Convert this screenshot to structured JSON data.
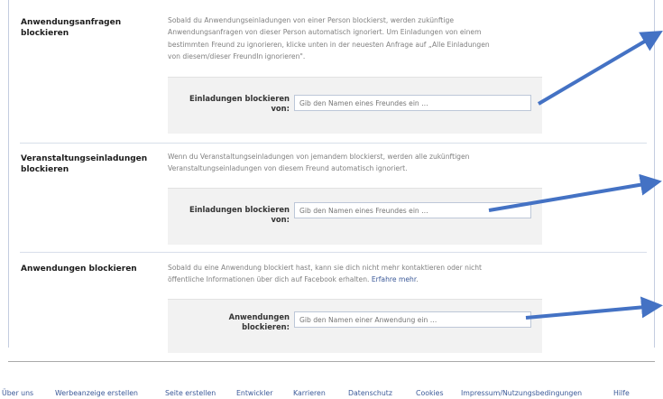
{
  "sections": [
    {
      "title_line1": "Anwendungsanfragen",
      "title_line2": "blockieren",
      "desc_lines": [
        "Sobald du Anwendungseinladungen von einer Person blockierst, werden zukünftige",
        "Anwendungsanfragen von dieser Person automatisch ignoriert. Um Einladungen von einem",
        "bestimmten Freund zu ignorieren, klicke unten in der neuesten Anfrage auf „Alle Einladungen",
        "von diesem/dieser FreundIn ignorieren\"."
      ],
      "field_label_line1": "Einladungen blockieren",
      "field_label_line2": "von:",
      "placeholder": "Gib den Namen eines Freundes ein …"
    },
    {
      "title_line1": "Veranstaltungseinladungen",
      "title_line2": "blockieren",
      "desc_lines": [
        "Wenn du Veranstaltungseinladungen von jemandem blockierst, werden alle zukünftigen",
        "Veranstaltungseinladungen von diesem Freund automatisch ignoriert."
      ],
      "field_label_line1": "Einladungen blockieren",
      "field_label_line2": "von:",
      "placeholder": "Gib den Namen eines Freundes ein …"
    },
    {
      "title_line1": "Anwendungen blockieren",
      "desc_line1": "Sobald du eine Anwendung blockiert hast, kann sie dich nicht mehr kontaktieren oder nicht",
      "desc_line2": "öffentliche Informationen über dich auf Facebook erhalten.",
      "desc_link": "Erfahre mehr",
      "desc_tail": ".",
      "field_label_line1": "Anwendungen",
      "field_label_line2": "blockieren:",
      "placeholder": "Gib den Namen einer Anwendung ein …"
    }
  ],
  "footer": [
    "Über uns",
    "Werbeanzeige erstellen",
    "Seite erstellen",
    "Entwickler",
    "Karrieren",
    "Datenschutz",
    "Cookies",
    "Impressum/Nutzungsbedingungen",
    "Hilfe"
  ],
  "colors": {
    "link": "#3b5998",
    "arrow": "#4472c4",
    "box": "#f2f2f2"
  }
}
